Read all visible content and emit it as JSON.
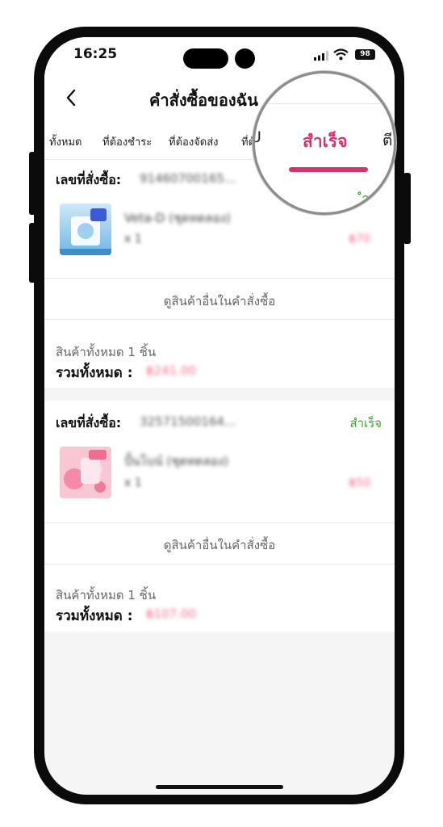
{
  "status_bar": {
    "time": "16:25",
    "battery": "98"
  },
  "header": {
    "title": "คำสั่งซื้อของฉัน",
    "back_icon": "chevron-left-icon"
  },
  "tabs": [
    {
      "label": "ทั้งหมด"
    },
    {
      "label": "ที่ต้องชำระ"
    },
    {
      "label": "ที่ต้องจัดส่ง"
    },
    {
      "label": "ที่ต้องได้รับ"
    },
    {
      "label": "สำเร็จ",
      "active": true
    }
  ],
  "magnifier": {
    "partial_left": "U",
    "active_tab": "สำเร็จ",
    "partial_right": "ตี",
    "status_fragment": "ำ"
  },
  "orders": [
    {
      "order_label": "เลขที่สั่งซื้อ:",
      "order_number": "91460700165...",
      "status": "",
      "product_name": "Veta-D (ชุดทดลอง)",
      "qty": "x 1",
      "price": "฿70",
      "view_more": "ดูสินค้าอื่นในคำสั่งซื้อ",
      "item_count": "สินค้าทั้งหมด 1 ชิ้น",
      "total_label": "รวมทั้งหมด :",
      "total": "฿241.00"
    },
    {
      "order_label": "เลขที่สั่งซื้อ:",
      "order_number": "32571500164...",
      "status": "สำเร็จ",
      "product_name": "ปั้นโบน์ (ชุดทดลอง)",
      "qty": "x 1",
      "price": "฿50",
      "view_more": "ดูสินค้าอื่นในคำสั่งซื้อ",
      "item_count": "สินค้าทั้งหมด 1 ชิ้น",
      "total_label": "รวมทั้งหมด :",
      "total": "฿107.00"
    }
  ],
  "colors": {
    "accent": "#d6336c",
    "success": "#3aa62f",
    "price": "#f06c8c"
  }
}
